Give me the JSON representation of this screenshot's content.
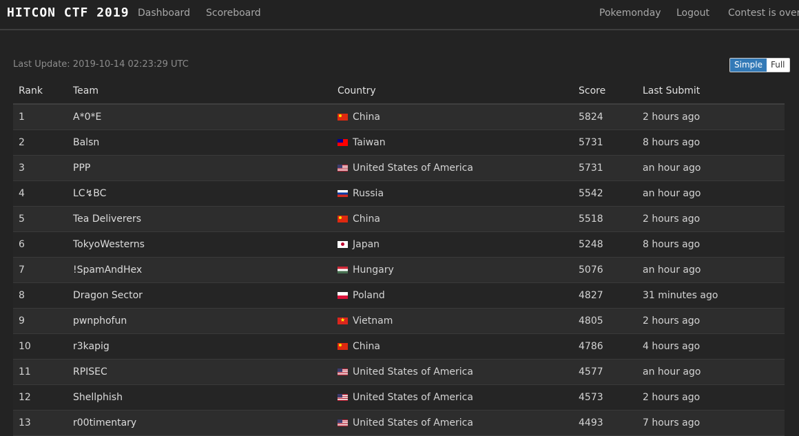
{
  "navbar": {
    "brand": "HITCON CTF 2019",
    "links": [
      "Dashboard",
      "Scoreboard"
    ],
    "right_links": [
      "Pokemonday",
      "Logout",
      "Contest is over"
    ]
  },
  "last_update": "Last Update: 2019-10-14 02:23:29 UTC",
  "view_toggle": {
    "simple": "Simple",
    "full": "Full",
    "active": "Simple"
  },
  "colors": {
    "accent": "#337ab7",
    "background": "#232323"
  },
  "table": {
    "headers": [
      "Rank",
      "Team",
      "Country",
      "Score",
      "Last Submit"
    ],
    "rows": [
      {
        "rank": "1",
        "team": "A*0*E",
        "flag": "cn",
        "country": "China",
        "score": "5824",
        "last_submit": "2 hours ago"
      },
      {
        "rank": "2",
        "team": "Balsn",
        "flag": "tw",
        "country": "Taiwan",
        "score": "5731",
        "last_submit": "8 hours ago"
      },
      {
        "rank": "3",
        "team": "PPP",
        "flag": "us",
        "country": "United States of America",
        "score": "5731",
        "last_submit": "an hour ago"
      },
      {
        "rank": "4",
        "team": "LC↯BC",
        "flag": "ru",
        "country": "Russia",
        "score": "5542",
        "last_submit": "an hour ago"
      },
      {
        "rank": "5",
        "team": "Tea Deliverers",
        "flag": "cn",
        "country": "China",
        "score": "5518",
        "last_submit": "2 hours ago"
      },
      {
        "rank": "6",
        "team": "TokyoWesterns",
        "flag": "jp",
        "country": "Japan",
        "score": "5248",
        "last_submit": "8 hours ago"
      },
      {
        "rank": "7",
        "team": "!SpamAndHex",
        "flag": "hu",
        "country": "Hungary",
        "score": "5076",
        "last_submit": "an hour ago"
      },
      {
        "rank": "8",
        "team": "Dragon Sector",
        "flag": "pl",
        "country": "Poland",
        "score": "4827",
        "last_submit": "31 minutes ago"
      },
      {
        "rank": "9",
        "team": "pwnphofun",
        "flag": "vn",
        "country": "Vietnam",
        "score": "4805",
        "last_submit": "2 hours ago"
      },
      {
        "rank": "10",
        "team": "r3kapig",
        "flag": "cn",
        "country": "China",
        "score": "4786",
        "last_submit": "4 hours ago"
      },
      {
        "rank": "11",
        "team": "RPISEC",
        "flag": "us",
        "country": "United States of America",
        "score": "4577",
        "last_submit": "an hour ago"
      },
      {
        "rank": "12",
        "team": "Shellphish",
        "flag": "us",
        "country": "United States of America",
        "score": "4573",
        "last_submit": "2 hours ago"
      },
      {
        "rank": "13",
        "team": "r00timentary",
        "flag": "us",
        "country": "United States of America",
        "score": "4493",
        "last_submit": "7 hours ago"
      }
    ]
  }
}
